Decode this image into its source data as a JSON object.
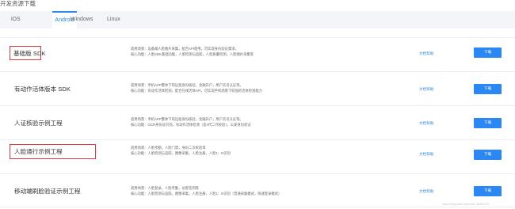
{
  "page": {
    "title": "开发资源下载"
  },
  "tabs": [
    {
      "label": "iOS"
    },
    {
      "label": "Android",
      "active": true
    },
    {
      "label": "Windows"
    },
    {
      "label": "Linux"
    }
  ],
  "rows": [
    {
      "title": "基础版 SDK",
      "highlighted": true,
      "lines": [
        "适用场景：设备端人脸图片采集，配合API使用，可实现身份验证需求。",
        "核心功能：人脸SDK基础功能，人脸检测与追踪，人脸质量检测，人脸图片采集等"
      ],
      "help": "文档帮助",
      "download": "下载"
    },
    {
      "title": "有动作活体版本 SDK",
      "highlighted": false,
      "lines": [
        "适用场景：手机APP整体下的远程身份核验，金融开户，用户实名认证等。",
        "核心功能：有动作活体检测，配合在线活体API，可实现手机场景下较强的活体检测能力"
      ],
      "help": "文档帮助",
      "download": "下载"
    },
    {
      "title": "人证核验示例工程",
      "highlighted": false,
      "lines": [
        "适用场景：手机APP整体下的远程身份核验，金融开户，用户实名认证等。",
        "核心功能：OCR身份证识别，有动作活体检测（含4代二代校验），公安身份验证"
      ],
      "help": "文档帮助",
      "download": "下载"
    },
    {
      "title": "人脸通行示例工程",
      "highlighted": true,
      "lines": [
        "适用场景：人脸考勤，人脸门禁，身份二次校验等",
        "核心功能：人脸检测与追踪，图像采集，人脸注册，人脸1：N识别"
      ],
      "help": "文档帮助",
      "download": "下载"
    },
    {
      "title": "移动端刷脸验证示例工程",
      "highlighted": false,
      "lines": [
        "适用场景：人脸登录，人脸考勤，访客签到等",
        "核心功能：人脸检测与追踪，图像采集，人脸注册，人脸1：N识别（普通采集模式，快速登录模式）"
      ],
      "help": "文档帮助",
      "download": "下载"
    }
  ],
  "watermark": "https://blog.csdn.net/sinat_36264723"
}
